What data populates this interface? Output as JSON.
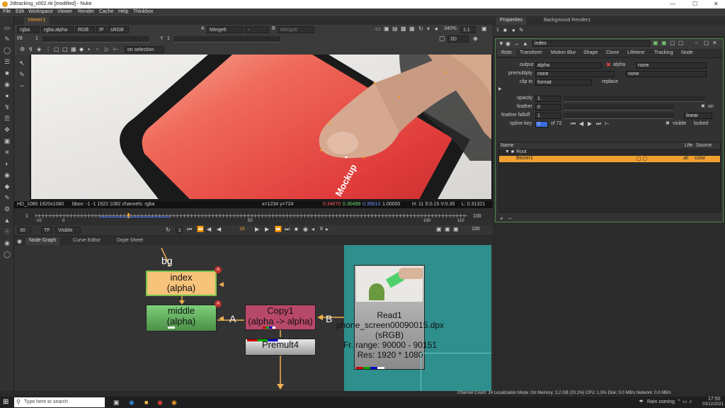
{
  "window": {
    "title": "2dtracking_v002.nk [modified] - Nuke"
  },
  "menu": [
    "File",
    "Edit",
    "Workspace",
    "Viewer",
    "Render",
    "Cache",
    "Help",
    "Thinkbox"
  ],
  "viewer_tab": "Viewer1",
  "viewer_controls": {
    "channels": "rgba",
    "layer": "rgba.alpha",
    "display": "RGB",
    "ip": "IP",
    "lut": "sRGB",
    "a_input": "A",
    "a_value": "Merge6",
    "a_sep": "-",
    "b_input": "B",
    "b_value": "Merge6",
    "fstop": "f/8",
    "gain": "1",
    "gamma_label": "Y",
    "gamma": "1",
    "zoom": "340%",
    "proxy": "1:1",
    "view": "2D",
    "frame_mode": "on selection",
    "pixel_aspect": "1"
  },
  "viewer_info": {
    "format": "HD_1080 1920x1080",
    "bbox": "bbox: -1 -1 1922 1082 channels: rgba",
    "coords": "x=1234 y=724",
    "r": "0.34670",
    "g": "0.30499",
    "b": "0.39614",
    "a": "1.00000",
    "hsv": "H: 11 S:0.15 V:0.35",
    "l": "L: 0.31321",
    "watermark": "Mockup"
  },
  "timeline": {
    "start": "1",
    "end": "100",
    "ticks": [
      "-10",
      "0",
      "50",
      "100",
      "110"
    ],
    "fps": "30",
    "tf": "TF",
    "range_mode": "Visible",
    "current_frame": "16",
    "step": "8",
    "end_field": "100",
    "start_field": "1",
    "end_right": "100"
  },
  "node_tabs": [
    "Node Graph",
    "Curve Editor",
    "Dope Sheet"
  ],
  "nodes": {
    "bg_label": "bg",
    "index_title": "index",
    "index_sub": "(alpha)",
    "middle_title": "middle",
    "middle_sub": "(alpha)",
    "copy_title": "Copy1",
    "copy_sub": "(alpha -> alpha)",
    "premult": "Premult4",
    "read_title": "Read1",
    "read_file": "phone_screen00090015.dpx",
    "read_cs": "(sRGB)",
    "read_range": "Fr. range: 90000 - 90151",
    "read_res": "Res: 1920 * 1080",
    "a_label": "A",
    "b_label": "B",
    "badge": "A"
  },
  "properties": {
    "tabs": [
      "Properties",
      "Background Renders"
    ],
    "max_panels": "1",
    "node_name": "index",
    "node_tabs": [
      "Roto",
      "Transform",
      "Motion Blur",
      "Shape",
      "Clone",
      "Lifetime",
      "Tracking",
      "Node"
    ],
    "output_label": "output",
    "output_value": "alpha",
    "output_alpha": "alpha",
    "output_none": "none",
    "premultiply_label": "premultiply",
    "premultiply_value": "none",
    "premultiply_none": "none",
    "clipto_label": "clip to",
    "clipto_value": "format",
    "replace_label": "replace",
    "opacity_label": "opacity",
    "opacity_value": "1",
    "feather_label": "feather",
    "feather_value": "0",
    "feather_on": "on",
    "falloff_label": "feather falloff",
    "falloff_value": "1",
    "falloff_mode": "linear",
    "splinekey_label": "spline key",
    "splinekey_value": "0",
    "splinekey_of": "of 72",
    "visible_label": "visible",
    "locked_label": "locked",
    "list_headers": {
      "name": "Name",
      "life": "Life",
      "source": "Source"
    },
    "root": "Root",
    "bezier": "Bezier1",
    "bezier_life": "all",
    "bezier_source": "color"
  },
  "status": "Channel Count: 24  Localization Mode: On  Memory: 3.2 GB (20.1%)  CPU: 1.5%  Disk: 0.0 MB/s  Network: 0.0 MB/s",
  "taskbar": {
    "search_placeholder": "Type here to search",
    "weather": "Rain coming",
    "time": "17:50",
    "date": "03/12/2021"
  },
  "colors": {
    "accent": "#f0a030",
    "index_node": "#f7c27a",
    "middle_node": "#7ed07a",
    "copy_node": "#b8486a",
    "teal": "#2e8f8c"
  }
}
